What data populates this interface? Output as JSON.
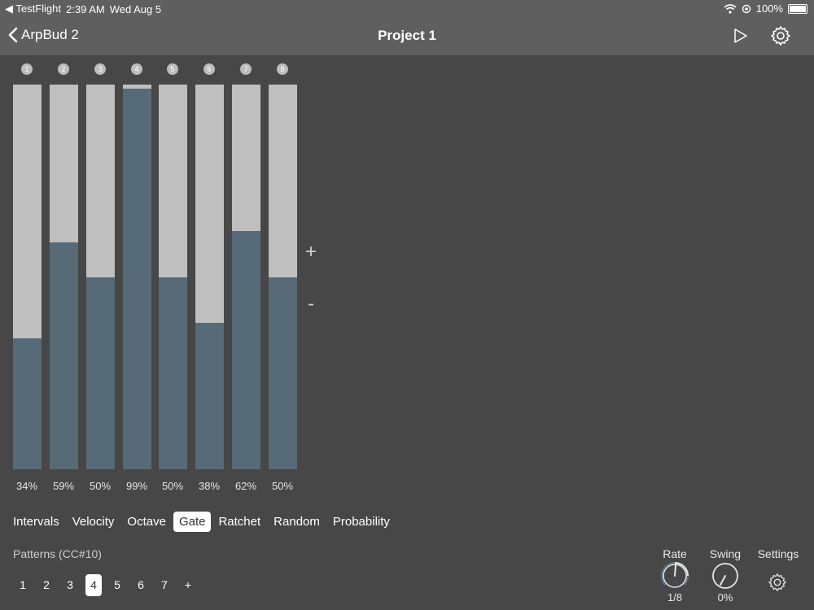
{
  "status_bar": {
    "app_back": "◀ TestFlight",
    "time": "2:39 AM",
    "date": "Wed Aug 5",
    "battery": "100%"
  },
  "nav": {
    "back_label": "ArpBud 2",
    "title": "Project 1"
  },
  "steps": [
    {
      "number": "1",
      "value_label": "34%",
      "value": 34
    },
    {
      "number": "2",
      "value_label": "59%",
      "value": 59
    },
    {
      "number": "3",
      "value_label": "50%",
      "value": 50
    },
    {
      "number": "4",
      "value_label": "99%",
      "value": 99
    },
    {
      "number": "5",
      "value_label": "50%",
      "value": 50
    },
    {
      "number": "6",
      "value_label": "38%",
      "value": 38
    },
    {
      "number": "7",
      "value_label": "62%",
      "value": 62
    },
    {
      "number": "8",
      "value_label": "50%",
      "value": 50
    }
  ],
  "controls": {
    "increment": "+",
    "decrement": "-"
  },
  "tabs": [
    {
      "label": "Intervals",
      "active": false
    },
    {
      "label": "Velocity",
      "active": false
    },
    {
      "label": "Octave",
      "active": false
    },
    {
      "label": "Gate",
      "active": true
    },
    {
      "label": "Ratchet",
      "active": false
    },
    {
      "label": "Random",
      "active": false
    },
    {
      "label": "Probability",
      "active": false
    }
  ],
  "patterns": {
    "label": "Patterns (CC#10)",
    "items": [
      {
        "label": "1",
        "active": false
      },
      {
        "label": "2",
        "active": false
      },
      {
        "label": "3",
        "active": false
      },
      {
        "label": "4",
        "active": true
      },
      {
        "label": "5",
        "active": false
      },
      {
        "label": "6",
        "active": false
      },
      {
        "label": "7",
        "active": false
      },
      {
        "label": "+",
        "active": false
      }
    ]
  },
  "rate": {
    "label": "Rate",
    "value": "1/8"
  },
  "swing": {
    "label": "Swing",
    "value": "0%"
  },
  "settings": {
    "label": "Settings"
  },
  "colors": {
    "background": "#474747",
    "bar_track": "#bfbfbf",
    "bar_fill": "#566b77",
    "nav_bg": "#5f5f5f"
  }
}
